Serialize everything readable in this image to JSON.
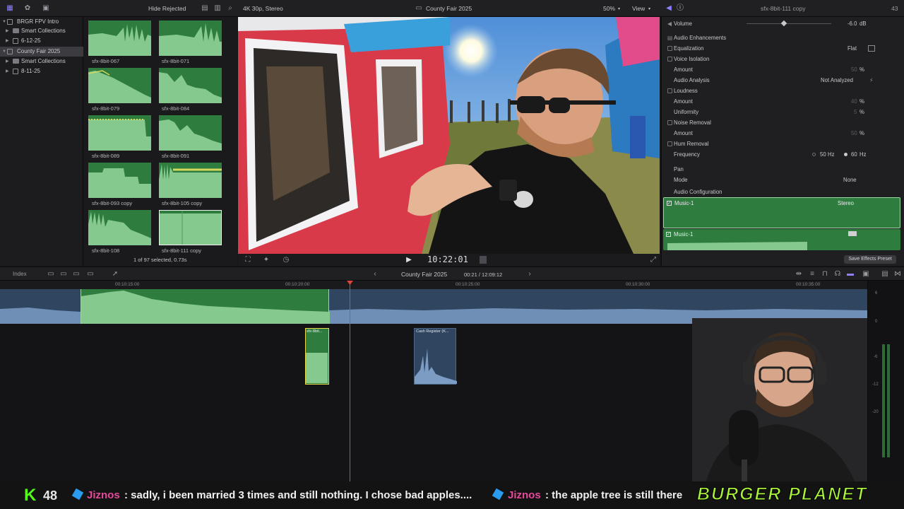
{
  "topbar": {
    "hide_rejected": "Hide Rejected",
    "format": "4K 30p, Stereo",
    "project": "County Fair 2025",
    "zoom": "50%",
    "view": "View",
    "inspector_title": "sfx-8bit-111 copy",
    "inspector_num": "43"
  },
  "library": {
    "items": [
      {
        "label": "BRGR FPV Intro"
      },
      {
        "label": "Smart Collections"
      },
      {
        "label": "6-12-25"
      },
      {
        "label": "County Fair 2025"
      },
      {
        "label": "Smart Collections"
      },
      {
        "label": "8-11-25"
      }
    ]
  },
  "browser": {
    "clips": [
      {
        "name": "sfx-8bit-067"
      },
      {
        "name": "sfx-8bit-071"
      },
      {
        "name": "sfx-8bit-079"
      },
      {
        "name": "sfx-8bit-084"
      },
      {
        "name": "sfx-8bit-089"
      },
      {
        "name": "sfx-8bit-091"
      },
      {
        "name": "sfx-8bit-093 copy"
      },
      {
        "name": "sfx-8bit-105 copy"
      },
      {
        "name": "sfx-8bit-108"
      },
      {
        "name": "sfx-8bit-111 copy"
      }
    ],
    "status": "1 of 97 selected, 0.73s"
  },
  "viewer": {
    "timecode": "10:22:01"
  },
  "inspector": {
    "volume_label": "Volume",
    "volume_value": "-6.0",
    "volume_unit": "dB",
    "enhancements": "Audio Enhancements",
    "equalization": "Equalization",
    "eq_value": "Flat",
    "voice_isolation": "Voice Isolation",
    "amount": "Amount",
    "vi_amount": "50",
    "audio_analysis": "Audio Analysis",
    "analysis_value": "Not Analyzed",
    "loudness": "Loudness",
    "loud_amount": "40",
    "uniformity": "Uniformity",
    "uniformity_value": "5",
    "noise_removal": "Noise Removal",
    "noise_amount": "50",
    "hum_removal": "Hum Removal",
    "frequency": "Frequency",
    "freq_50": "50",
    "freq_60": "60",
    "hz": "Hz",
    "pct": "%",
    "pan": "Pan",
    "mode": "Mode",
    "mode_value": "None",
    "audio_config": "Audio Configuration",
    "config_track": "Music-1",
    "config_value": "Stereo",
    "config_sub": "Music-1",
    "save_preset": "Save Effects Preset"
  },
  "timeline": {
    "index": "Index",
    "project": "County Fair 2025",
    "duration": "00:21 / 12:09:12",
    "ruler": [
      "00:10:15:00",
      "00:10:20:00",
      "00:10:25:00",
      "00:10:30:00",
      "00:10:35:00"
    ],
    "clip_sfx": "sfx-8bit...",
    "clip_cash": "Cash Register (K..."
  },
  "meter": {
    "labels": [
      "6",
      "0",
      "-6",
      "-12",
      "-20"
    ]
  },
  "ticker": {
    "k": "K",
    "count": "48",
    "user1": "Jiznos",
    "msg1": ": sadly, i been married 3 times and still nothing. I chose bad apples....",
    "user2": "Jiznos",
    "msg2": ": the apple tree is still there",
    "brand": "BURGER PLANET"
  },
  "colors": {
    "clip_green": "#2e7d3e",
    "wave_green": "#86c98e",
    "audio_blue": "#4a6b94",
    "playhead": "#e0433a",
    "accent": "#7a6cf0"
  }
}
